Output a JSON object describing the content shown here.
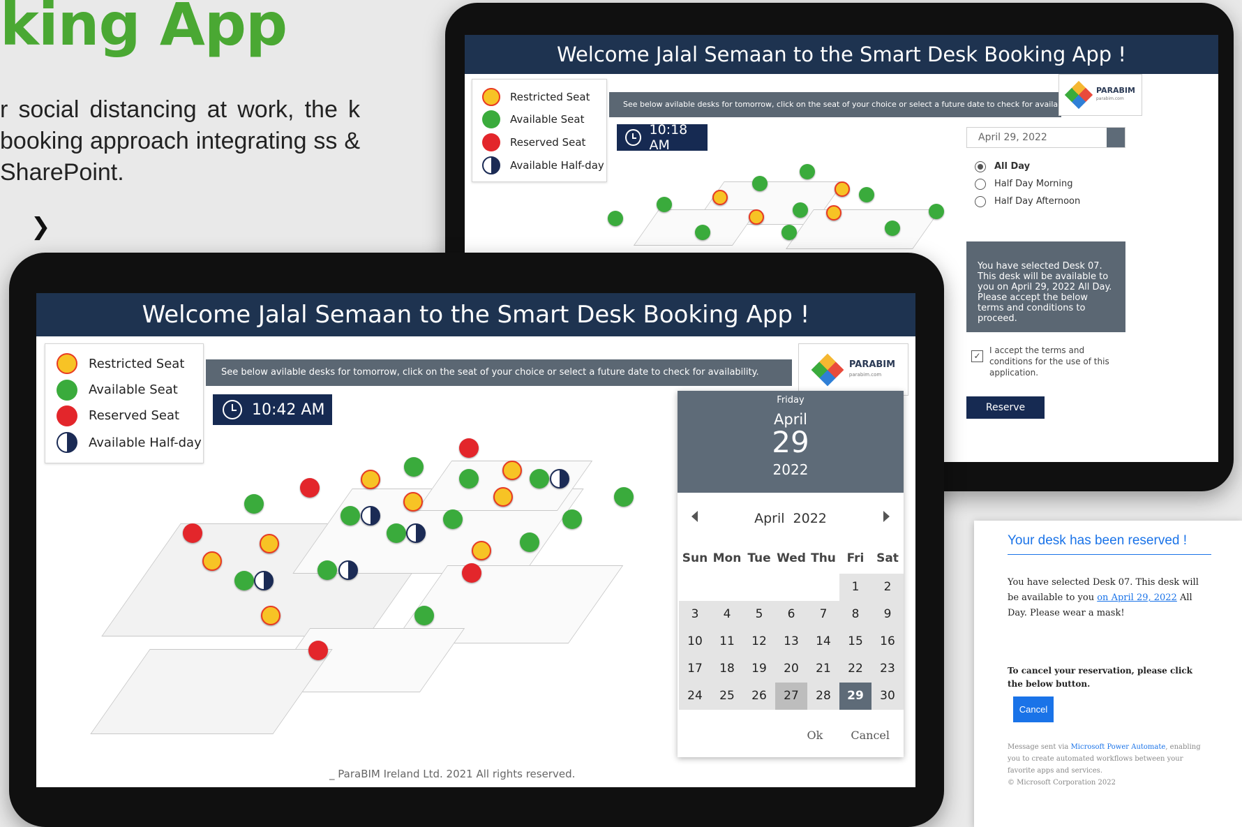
{
  "marketing": {
    "headline": "king App",
    "description": "r  social  distancing  at  work,  the k  booking  approach  integrating ss & SharePoint.",
    "arrow": "❯"
  },
  "legend": {
    "restricted": "Restricted Seat",
    "available": "Available Seat",
    "reserved": "Reserved Seat",
    "half_day": "Available Half-day"
  },
  "back_tablet": {
    "title": "Welcome Jalal Semaan to the Smart Desk Booking App !",
    "notice": "See below avilable desks for tomorrow, click on the seat of your choice or select a future date to check for availability.",
    "time": "10:18 AM",
    "date_value": "April 29, 2022",
    "options": [
      "All Day",
      "Half Day Morning",
      "Half Day Afternoon"
    ],
    "selected_option": "All Day",
    "info": "You have selected Desk 07. This desk will be available to you on April 29, 2022 All Day. Please accept the below terms and conditions to proceed.",
    "terms": "I accept the terms and conditions for the use of this application.",
    "reserve_button": "Reserve",
    "logo_text": "PARABIM",
    "logo_sub": "parabim.com"
  },
  "front_tablet": {
    "title": "Welcome Jalal Semaan to the Smart Desk Booking App !",
    "notice": "See below avilable desks for tomorrow, click on the seat of your choice or select a future date to check for availability.",
    "time": "10:42 AM",
    "footer": "_ ParaBIM Ireland Ltd. 2021 All rights reserved.",
    "logo_text": "PARABIM",
    "logo_sub": "parabim.com"
  },
  "calendar": {
    "weekday": "Friday",
    "month": "April",
    "day": "29",
    "year": "2022",
    "nav_month": "April",
    "nav_year": "2022",
    "dow": [
      "Sun",
      "Mon",
      "Tue",
      "Wed",
      "Thu",
      "Fri",
      "Sat"
    ],
    "weeks": [
      [
        "",
        "",
        "",
        "",
        "",
        "1",
        "2"
      ],
      [
        "3",
        "4",
        "5",
        "6",
        "7",
        "8",
        "9"
      ],
      [
        "10",
        "11",
        "12",
        "13",
        "14",
        "15",
        "16"
      ],
      [
        "17",
        "18",
        "19",
        "20",
        "21",
        "22",
        "23"
      ],
      [
        "24",
        "25",
        "26",
        "27",
        "28",
        "29",
        "30"
      ]
    ],
    "today": "27",
    "selected": "29",
    "ok": "Ok",
    "cancel": "Cancel"
  },
  "email": {
    "title": "Your desk has been reserved !",
    "body_pre": "You have selected Desk 07. This desk will be available to you ",
    "body_link": "on April 29, 2022",
    "body_post": " All Day. Please wear a mask!",
    "cancel_note": "To cancel your reservation, please click the below button.",
    "cancel_button": "Cancel",
    "footer_pre": "Message sent via ",
    "footer_link": "Microsoft Power Automate",
    "footer_post": ", enabling you to create automated workflows between your favorite apps and services.",
    "copyright": "© Microsoft Corporation 2022"
  },
  "colors": {
    "accent_green": "#4aa833",
    "title_navy": "#1e3350",
    "restricted": "#f7c325",
    "available": "#3aab3c",
    "reserved": "#e3262b",
    "half_day": "#1b2b55",
    "email_blue": "#1a73e8"
  },
  "icons": [
    "restricted-seat-icon",
    "available-seat-icon",
    "reserved-seat-icon",
    "half-day-icon",
    "clock-icon",
    "calendar-icon",
    "chevron-right-icon",
    "chevron-left-icon",
    "checkbox-icon"
  ]
}
